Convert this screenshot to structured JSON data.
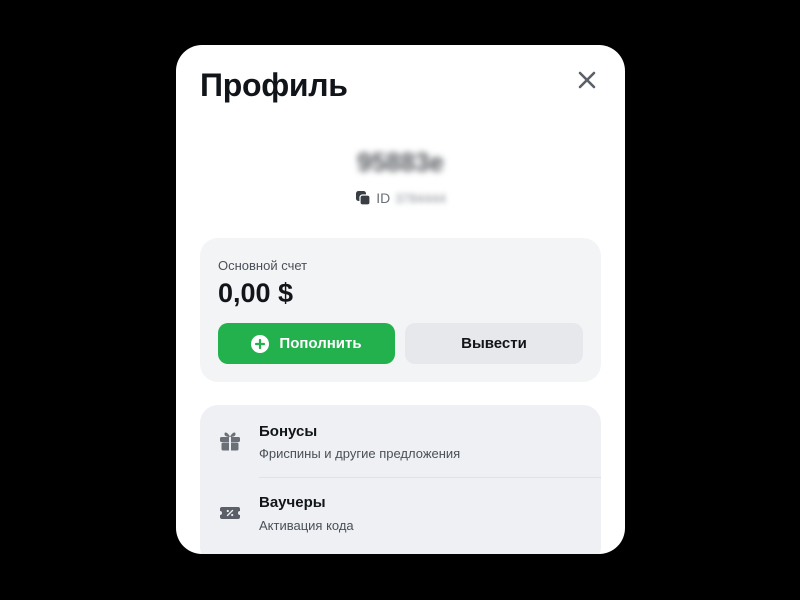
{
  "modal": {
    "title": "Профиль"
  },
  "profile": {
    "username": "95883e",
    "id_label": "ID",
    "id_value": "3784444"
  },
  "balance": {
    "label": "Основной счет",
    "amount": "0,00 $",
    "deposit_label": "Пополнить",
    "withdraw_label": "Вывести"
  },
  "menu": {
    "items": [
      {
        "title": "Бонусы",
        "subtitle": "Фриспины и другие предложения",
        "icon": "gift-icon"
      },
      {
        "title": "Ваучеры",
        "subtitle": "Активация кода",
        "icon": "voucher-icon"
      }
    ]
  },
  "colors": {
    "accent": "#23b14d",
    "backdrop": "#000000",
    "card": "#f3f4f6"
  }
}
